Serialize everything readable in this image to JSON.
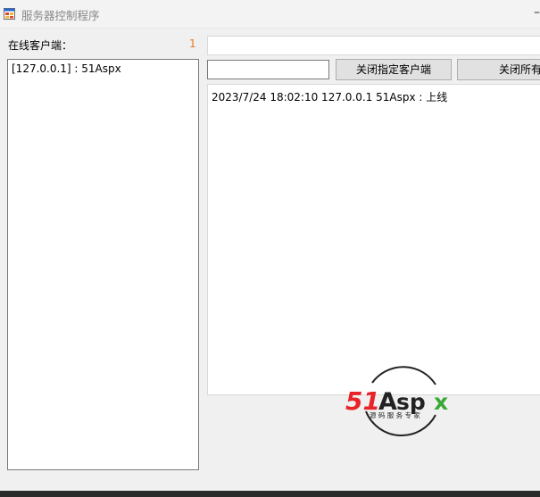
{
  "window": {
    "title": "服务器控制程序",
    "icon": "app-window-icon",
    "minimize_glyph": "–"
  },
  "clients": {
    "label": "在线客户端：",
    "count": "1",
    "items": [
      {
        "label": "[127.0.0.1] : 51Aspx"
      }
    ]
  },
  "top_input": {
    "value": ""
  },
  "client_input": {
    "value": ""
  },
  "buttons": {
    "close_one": "关闭指定客户端",
    "close_all": "关闭所有"
  },
  "log": {
    "lines": [
      "2023/7/24 18:02:10 127.0.0.1 51Aspx : 上线"
    ]
  },
  "watermark": {
    "brand_num": "51",
    "brand_a": "A",
    "brand_sp": "sp",
    "brand_x": "x",
    "tagline": "源 码 服 务 专 家",
    "colors": {
      "red": "#e8242a",
      "green": "#39a935",
      "dark": "#222222"
    }
  }
}
